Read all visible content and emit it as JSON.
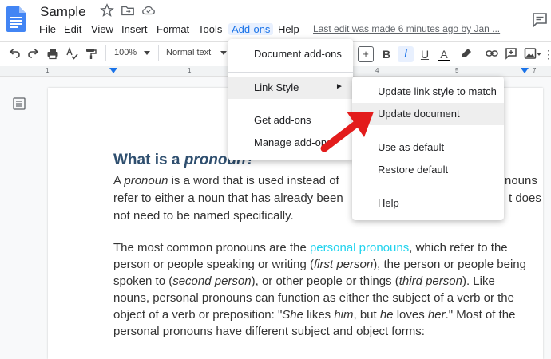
{
  "app": {
    "doc_title": "Sample",
    "last_edit": "Last edit was made 6 minutes ago by Jan ..."
  },
  "menubar": [
    "File",
    "Edit",
    "View",
    "Insert",
    "Format",
    "Tools",
    "Add-ons",
    "Help"
  ],
  "toolbar": {
    "zoom": "100%",
    "style": "Normal text",
    "plus": "+",
    "bold": "B",
    "italic": "I",
    "underline": "U",
    "text_color": "A"
  },
  "ruler": {
    "numbers": [
      "1",
      "1",
      "1",
      "2",
      "3",
      "4",
      "5",
      "6",
      "7"
    ]
  },
  "addons_menu": {
    "items": [
      "Document add-ons",
      "Link Style",
      "Get add-ons",
      "Manage add-ons"
    ],
    "submenu_arrow": "►"
  },
  "link_style_submenu": {
    "items": [
      "Update link style to match",
      "Update document",
      "Use as default",
      "Restore default",
      "Help"
    ]
  },
  "document": {
    "heading_prefix": "What is a ",
    "heading_em": "pronoun?",
    "p1": {
      "l1a": "A ",
      "l1b": "pronoun",
      "l1c": " is a word that is used instead of",
      "l1d": "nouns",
      "l2a": "refer to either a noun that has already been",
      "l2b": "t does",
      "l3": "not need to be named specifically."
    },
    "p2": {
      "l1a": "The most common pronouns are the ",
      "l1b": "personal pronouns",
      "l1c": ", which refer to the",
      "l2a": "person or people speaking or writing (",
      "l2b": "first person",
      "l2c": "), the person or people being",
      "l3a": "spoken to (",
      "l3b": "second person",
      "l3c": "), or other people or things (",
      "l3d": "third person",
      "l3e": "). Like",
      "l4": "nouns, personal pronouns can function as either the subject of a verb or the",
      "l5a": "object of a verb or preposition: \"",
      "l5b": "She",
      "l5c": " likes ",
      "l5d": "him",
      "l5e": ", but ",
      "l5f": "he",
      "l5g": " loves ",
      "l5h": "her",
      "l5i": ".\" Most of the",
      "l6": "personal pronouns have different subject and object forms:"
    }
  },
  "colors": {
    "accent": "#1a73e8",
    "highlight_link": "#22d3ee",
    "arrow": "#e31c1c"
  }
}
